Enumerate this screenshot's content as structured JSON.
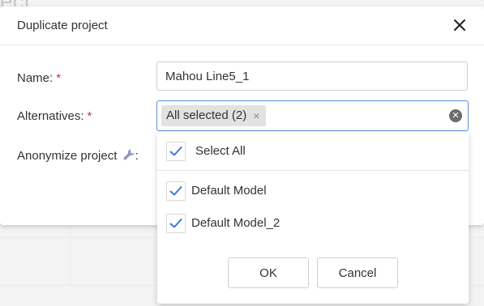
{
  "background": {
    "page_title_fragment": "ect"
  },
  "dialog": {
    "title": "Duplicate project",
    "close_icon": "close-icon",
    "fields": {
      "name": {
        "label": "Name:",
        "required_mark": "*",
        "value": "Mahou Line5_1"
      },
      "alternatives": {
        "label": "Alternatives:",
        "required_mark": "*",
        "chip_label": "All selected (2)",
        "chip_remove_glyph": "×",
        "clear_glyph": "✕"
      },
      "anonymize": {
        "label": "Anonymize project",
        "icon": "wrench-icon",
        "suffix": ":"
      }
    },
    "dropdown": {
      "select_all": {
        "label": "Select All",
        "checked": true
      },
      "options": [
        {
          "label": "Default Model",
          "checked": true
        },
        {
          "label": "Default Model_2",
          "checked": true
        }
      ],
      "ok_label": "OK",
      "cancel_label": "Cancel"
    }
  },
  "colors": {
    "required": "#d32f2f",
    "focus_border": "#5b8cd6",
    "check": "#3a7bd5"
  }
}
